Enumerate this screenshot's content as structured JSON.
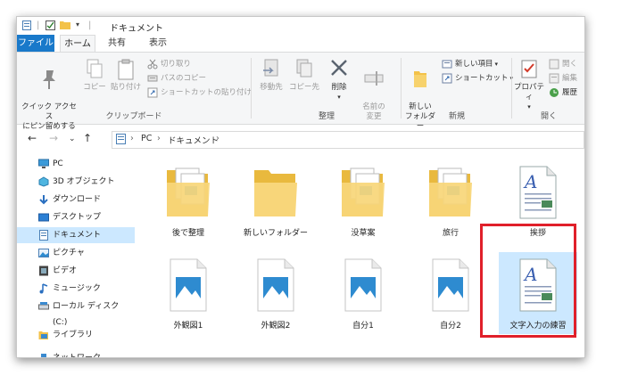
{
  "window": {
    "title": "ドキュメント"
  },
  "tabs": {
    "file": "ファイル",
    "home": "ホーム",
    "share": "共有",
    "view": "表示"
  },
  "ribbon": {
    "clipboard": {
      "label": "クリップボード",
      "pin": "クイック アクセス\nにピン留めする",
      "copy": "コピー",
      "paste": "貼り付け",
      "cut": "切り取り",
      "copy_path": "パスのコピー",
      "paste_shortcut": "ショートカットの貼り付け"
    },
    "organize": {
      "label": "整理",
      "move_to": "移動先",
      "copy_to": "コピー先",
      "delete": "削除",
      "rename": "名前の\n変更"
    },
    "new": {
      "label": "新規",
      "new_folder": "新しい\nフォルダー",
      "new_item": "新しい項目",
      "shortcut": "ショートカット"
    },
    "open": {
      "label": "開く",
      "properties": "プロパティ",
      "open": "開く",
      "edit": "編集",
      "history": "履歴"
    }
  },
  "address": {
    "segments": [
      "PC",
      "ドキュメント"
    ]
  },
  "navpane": {
    "items": [
      {
        "label": "PC",
        "icon": "pc-icon"
      },
      {
        "label": "3D オブジェクト",
        "icon": "3d-objects-icon"
      },
      {
        "label": "ダウンロード",
        "icon": "download-icon"
      },
      {
        "label": "デスクトップ",
        "icon": "desktop-icon"
      },
      {
        "label": "ドキュメント",
        "icon": "documents-icon",
        "selected": true
      },
      {
        "label": "ピクチャ",
        "icon": "pictures-icon"
      },
      {
        "label": "ビデオ",
        "icon": "video-icon"
      },
      {
        "label": "ミュージック",
        "icon": "music-icon"
      },
      {
        "label": "ローカル ディスク (C:)",
        "icon": "drive-icon"
      },
      {
        "label": "ライブラリ",
        "icon": "library-icon"
      },
      {
        "label": "ネットワーク",
        "icon": "network-icon"
      }
    ]
  },
  "files": [
    {
      "name": "後で整理",
      "type": "folder-docs"
    },
    {
      "name": "新しいフォルダー",
      "type": "folder-empty"
    },
    {
      "name": "没草案",
      "type": "folder-docs"
    },
    {
      "name": "旅行",
      "type": "folder-docs"
    },
    {
      "name": "挨拶",
      "type": "wordpad-doc"
    },
    {
      "name": "外観図1",
      "type": "image"
    },
    {
      "name": "外観図2",
      "type": "image"
    },
    {
      "name": "自分1",
      "type": "image"
    },
    {
      "name": "自分2",
      "type": "image"
    },
    {
      "name": "文字入力の練習",
      "type": "wordpad-doc",
      "selected": true
    }
  ],
  "colors": {
    "accent": "#1979ca",
    "selection": "#cce8ff",
    "highlight_box": "#e0202a"
  }
}
